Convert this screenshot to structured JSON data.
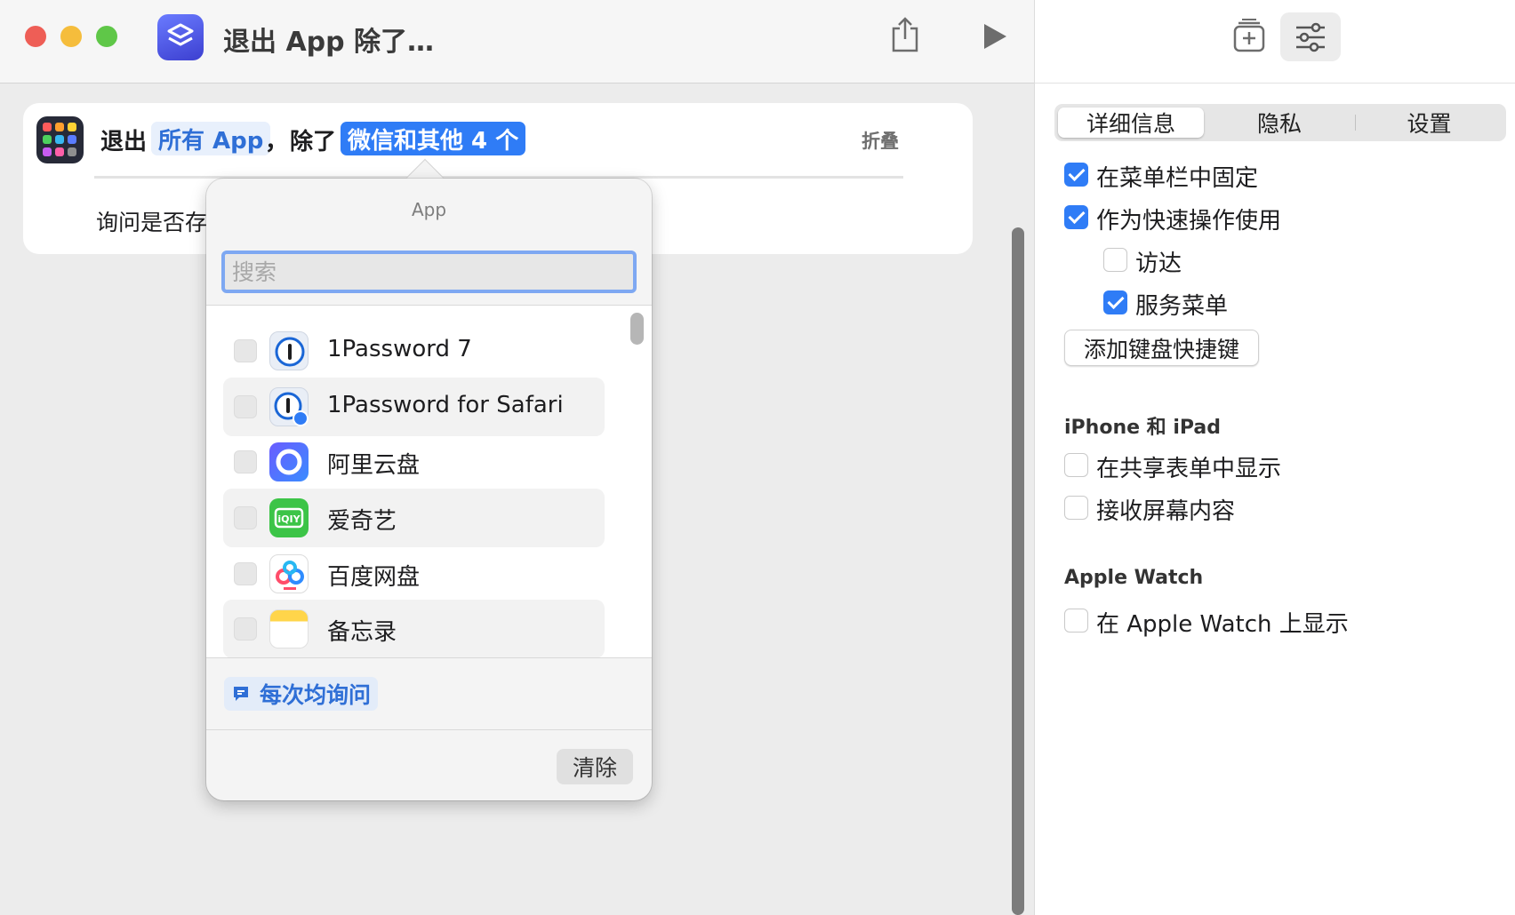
{
  "window": {
    "title": "退出 App 除了…",
    "traffic_colors": {
      "close": "#ee5e56",
      "minimize": "#f5bd3c",
      "zoom": "#5fc748"
    }
  },
  "action": {
    "verb": "退出",
    "target_token": "所有 App",
    "separator": "，",
    "except_label": "除了",
    "except_token": "微信和其他 4 个",
    "fold_label": "折叠",
    "ask_text": "询问是否存"
  },
  "popover": {
    "title": "App",
    "search_placeholder": "搜索",
    "apps": [
      {
        "label": "1Password 7",
        "icon": "1password-icon",
        "checked": false
      },
      {
        "label": "1Password for Safari",
        "icon": "1password-safari-icon",
        "checked": false
      },
      {
        "label": "阿里云盘",
        "icon": "aliyun-drive-icon",
        "checked": false
      },
      {
        "label": "爱奇艺",
        "icon": "iqiyi-icon",
        "checked": false
      },
      {
        "label": "百度网盘",
        "icon": "baidu-netdisk-icon",
        "checked": false
      },
      {
        "label": "备忘录",
        "icon": "notes-icon",
        "checked": false
      }
    ],
    "ask_every_time": "每次均询问",
    "clear_button": "清除"
  },
  "inspector": {
    "tabs": [
      "详细信息",
      "隐私",
      "设置"
    ],
    "active_tab": "详细信息",
    "options": [
      {
        "label": "在菜单栏中固定",
        "checked": true
      },
      {
        "label": "作为快速操作使用",
        "checked": true
      },
      {
        "label": "访达",
        "checked": false
      },
      {
        "label": "服务菜单",
        "checked": true
      }
    ],
    "keyboard_shortcut_button": "添加键盘快捷键",
    "iphone_section": {
      "heading": "iPhone 和 iPad",
      "options": [
        {
          "label": "在共享表单中显示",
          "checked": false
        },
        {
          "label": "接收屏幕内容",
          "checked": false
        }
      ]
    },
    "watch_section": {
      "heading": "Apple Watch",
      "options": [
        {
          "label": "在 Apple Watch 上显示",
          "checked": false
        }
      ]
    }
  },
  "accent_color": "#2f7cf6"
}
